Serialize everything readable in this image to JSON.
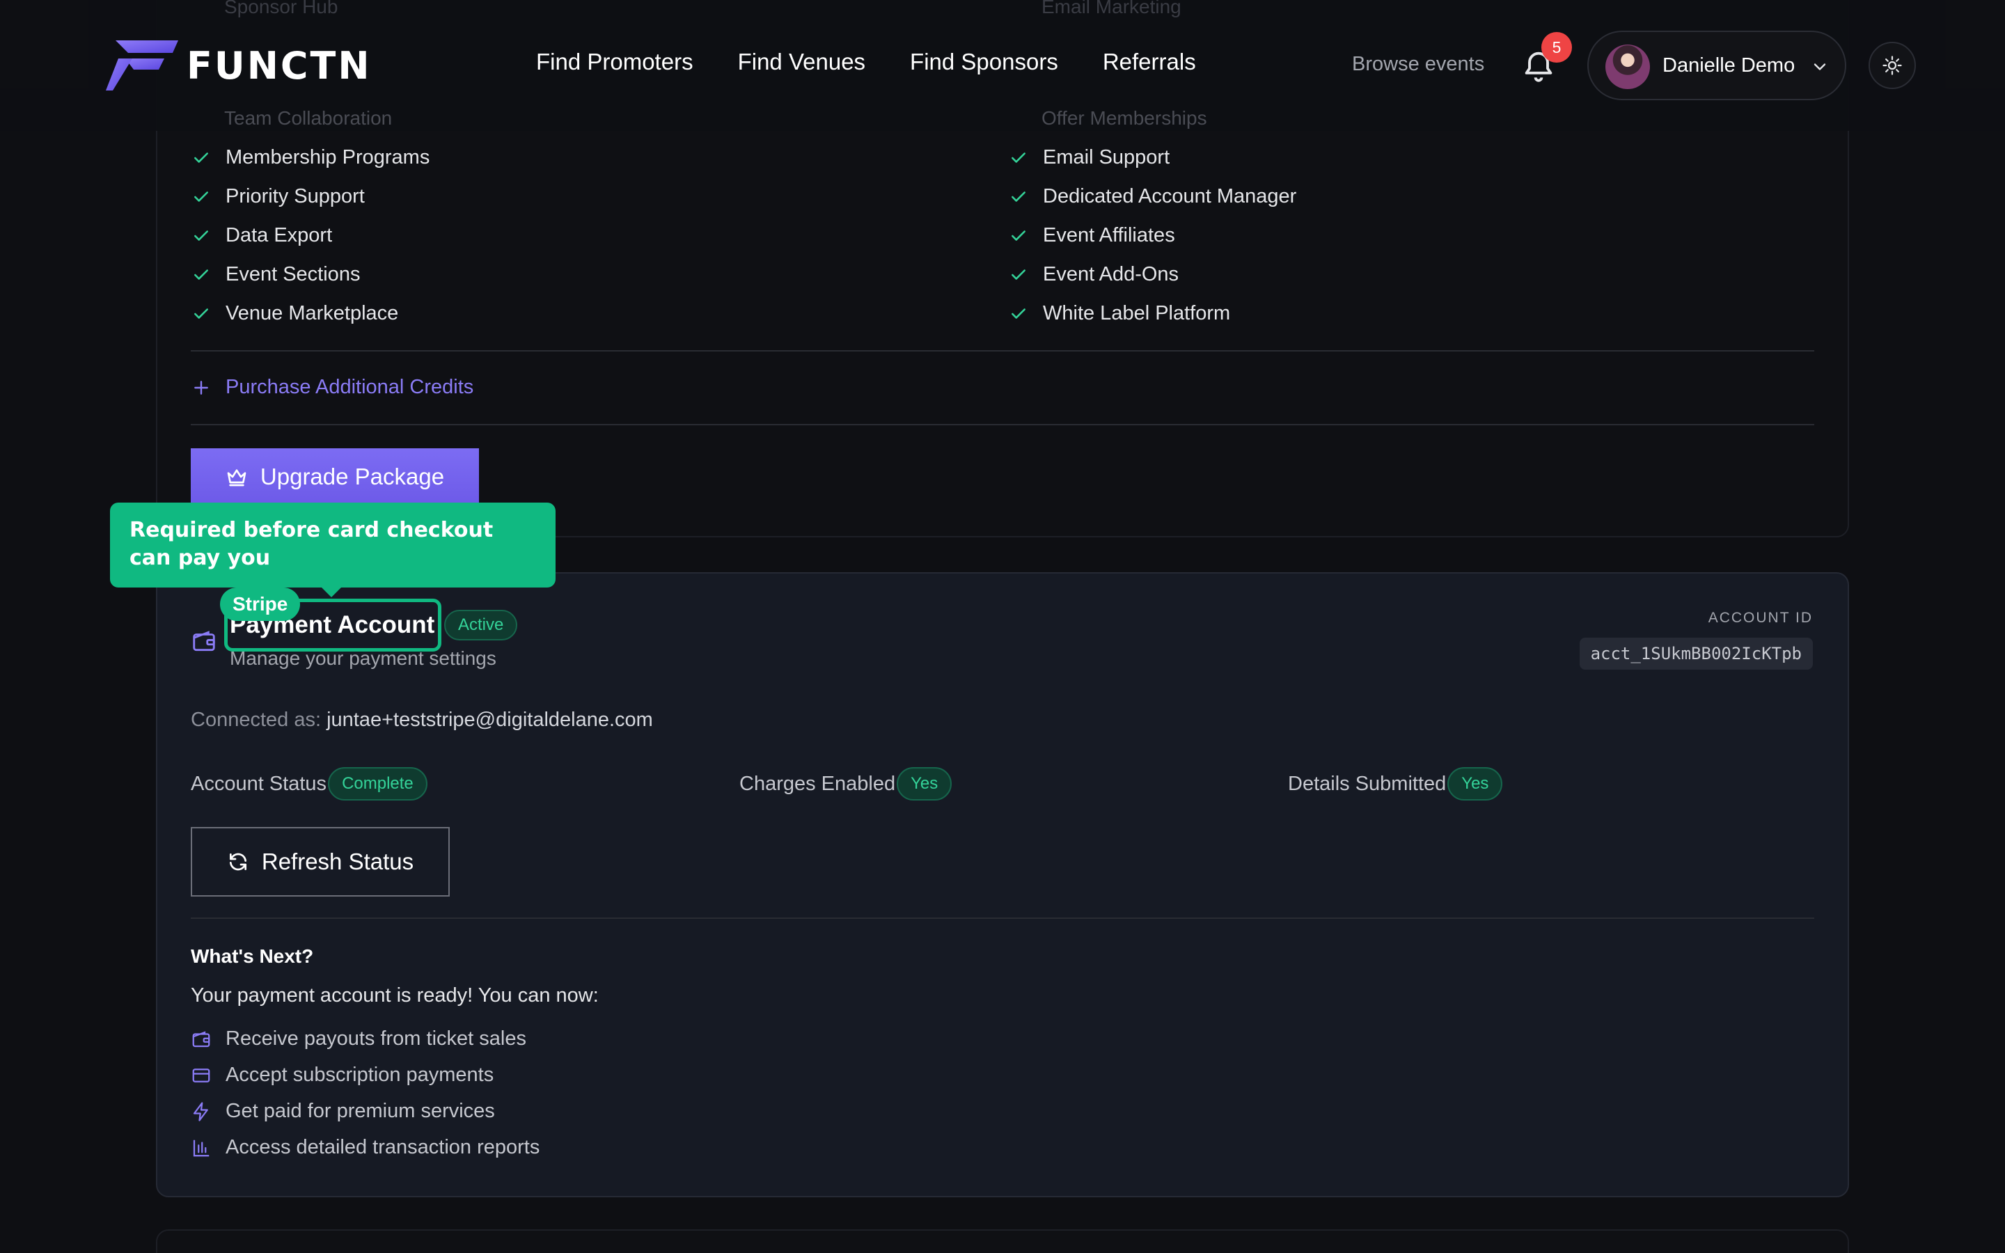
{
  "header": {
    "logo_text": "FUNCTN",
    "nav": [
      "Find Promoters",
      "Find Venues",
      "Find Sponsors",
      "Referrals"
    ],
    "browse": "Browse events",
    "notification_count": "5",
    "user_name": "Danielle Demo"
  },
  "ghost_items": {
    "left_top": "Sponsor Hub",
    "left_bottom": "Team Collaboration",
    "right_top": "Email Marketing",
    "right_bottom": "Offer Memberships"
  },
  "package": {
    "features_left": [
      "Membership Programs",
      "Priority Support",
      "Data Export",
      "Event Sections",
      "Venue Marketplace"
    ],
    "features_right": [
      "Email Support",
      "Dedicated Account Manager",
      "Event Affiliates",
      "Event Add-Ons",
      "White Label Platform"
    ],
    "purchase_label": "Purchase Additional Credits",
    "upgrade_label": "Upgrade Package"
  },
  "tooltip": {
    "text": "Required before card checkout can pay you",
    "tag": "Stripe"
  },
  "payment": {
    "title": "Payment Account",
    "status_badge": "Active",
    "subtitle": "Manage your payment settings",
    "account_id_label": "ACCOUNT ID",
    "account_id": "acct_1SUkmBB002IcKTpb",
    "connected_label": "Connected as:",
    "connected_email": "juntae+teststripe@digitaldelane.com",
    "stats": [
      {
        "label": "Account Status",
        "value": "Complete"
      },
      {
        "label": "Charges Enabled",
        "value": "Yes"
      },
      {
        "label": "Details Submitted",
        "value": "Yes"
      }
    ],
    "refresh_label": "Refresh Status",
    "next_title": "What's Next?",
    "next_desc": "Your payment account is ready! You can now:",
    "perks": [
      "Receive payouts from ticket sales",
      "Accept subscription payments",
      "Get paid for premium services",
      "Access detailed transaction reports"
    ]
  },
  "colors": {
    "accent": "#7c6cf3",
    "success": "#10b981",
    "check": "#34d399"
  }
}
